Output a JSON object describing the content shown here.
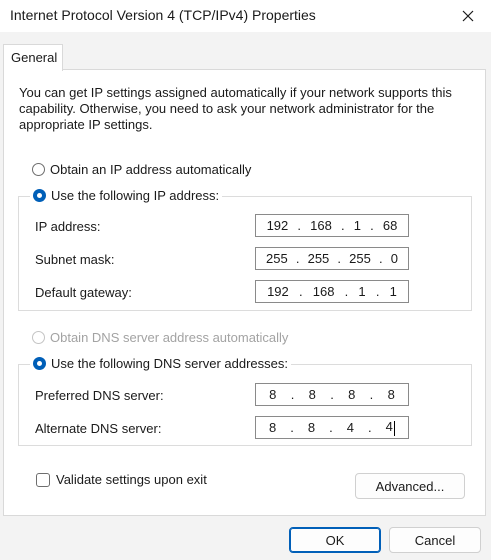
{
  "window": {
    "title": "Internet Protocol Version 4 (TCP/IPv4) Properties",
    "close_icon": "close-icon"
  },
  "tabs": [
    "General"
  ],
  "description": "You can get IP settings assigned automatically if your network supports this capability. Otherwise, you need to ask your network administrator for the appropriate IP settings.",
  "ip_section": {
    "auto_label": "Obtain an IP address automatically",
    "manual_label": "Use the following IP address:",
    "selected": "manual",
    "fields": {
      "ip_address": {
        "label": "IP address:",
        "octets": [
          "192",
          "168",
          "1",
          "68"
        ]
      },
      "subnet_mask": {
        "label": "Subnet mask:",
        "octets": [
          "255",
          "255",
          "255",
          "0"
        ]
      },
      "default_gateway": {
        "label": "Default gateway:",
        "octets": [
          "192",
          "168",
          "1",
          "1"
        ]
      }
    }
  },
  "dns_section": {
    "auto_label": "Obtain DNS server address automatically",
    "auto_disabled": true,
    "manual_label": "Use the following DNS server addresses:",
    "selected": "manual",
    "fields": {
      "preferred": {
        "label": "Preferred DNS server:",
        "octets": [
          "8",
          "8",
          "8",
          "8"
        ]
      },
      "alternate": {
        "label": "Alternate DNS server:",
        "octets": [
          "8",
          "8",
          "4",
          "4"
        ]
      }
    }
  },
  "validate": {
    "label": "Validate settings upon exit",
    "checked": false
  },
  "buttons": {
    "advanced": "Advanced...",
    "ok": "OK",
    "cancel": "Cancel"
  },
  "colors": {
    "accent": "#005fb8",
    "window_bg": "#f3f3f3",
    "panel_bg": "#ffffff"
  }
}
